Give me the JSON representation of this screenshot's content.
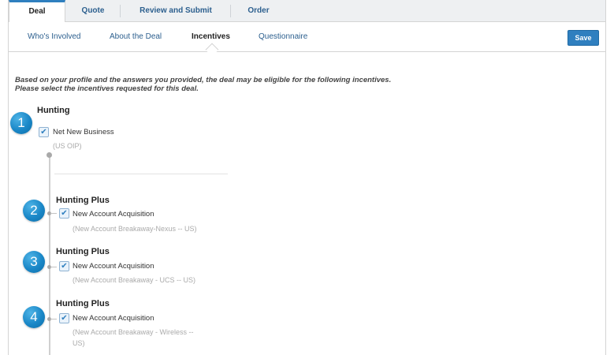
{
  "top_tabs": [
    {
      "label": "Deal",
      "active": true
    },
    {
      "label": "Quote",
      "active": false
    },
    {
      "label": "Review and Submit",
      "active": false
    },
    {
      "label": "Order",
      "active": false
    }
  ],
  "sub_tabs": [
    {
      "label": "Who's Involved",
      "active": false
    },
    {
      "label": "About the Deal",
      "active": false
    },
    {
      "label": "Incentives",
      "active": true
    },
    {
      "label": "Questionnaire",
      "active": false
    }
  ],
  "save_label": "Save",
  "intro": {
    "line1": "Based on your profile and the answers you provided, the deal may be eligible for the following incentives.",
    "line2": "Please select the incentives requested for this deal."
  },
  "incentives": [
    {
      "badge": "1",
      "title": "Hunting",
      "option_label": "Net New Business",
      "checked": true,
      "program": "(US OIP)",
      "program_line2": ""
    },
    {
      "badge": "2",
      "title": "Hunting Plus",
      "option_label": "New Account Acquisition",
      "checked": true,
      "program": "(New Account Breakaway-Nexus -- US)",
      "program_line2": ""
    },
    {
      "badge": "3",
      "title": "Hunting Plus",
      "option_label": "New Account Acquisition",
      "checked": true,
      "program": "(New Account Breakaway - UCS -- US)",
      "program_line2": ""
    },
    {
      "badge": "4",
      "title": "Hunting Plus",
      "option_label": "New Account Acquisition",
      "checked": true,
      "program": "(New Account Breakaway - Wireless --",
      "program_line2": "US)"
    }
  ],
  "checkmark": "✔",
  "colors": {
    "accent": "#2f7fbf",
    "badge": "#1a87c7",
    "link": "#2c5f8e",
    "muted": "#aaaaaa"
  }
}
